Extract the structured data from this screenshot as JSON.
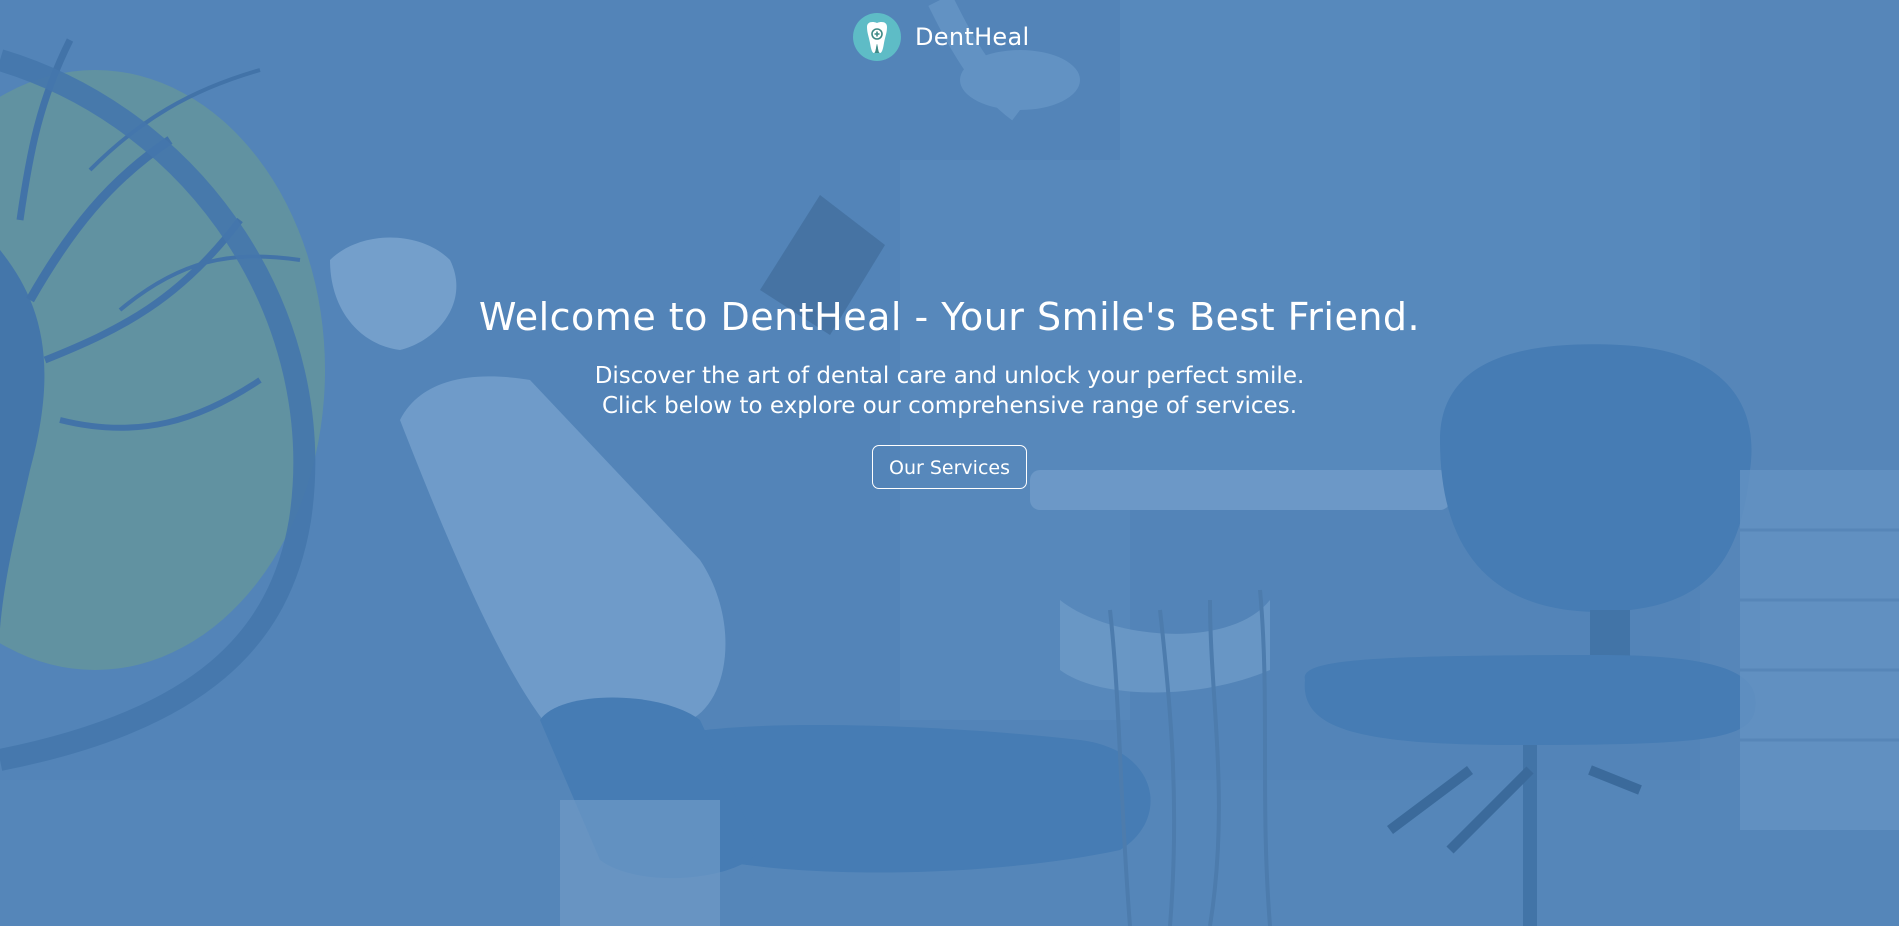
{
  "header": {
    "brand_name": "DentHeal",
    "logo_icon": "tooth-icon"
  },
  "hero": {
    "title": "Welcome to DentHeal - Your Smile's Best Friend.",
    "subtitle_line1": "Discover the art of dental care and unlock your perfect smile.",
    "subtitle_line2": "Click below to explore our comprehensive range of services.",
    "cta_label": "Our Services",
    "background": "dental-clinic-photo"
  },
  "colors": {
    "overlay": "#5385b8",
    "logo_circle": "#5ebcc6",
    "text": "#ffffff"
  }
}
